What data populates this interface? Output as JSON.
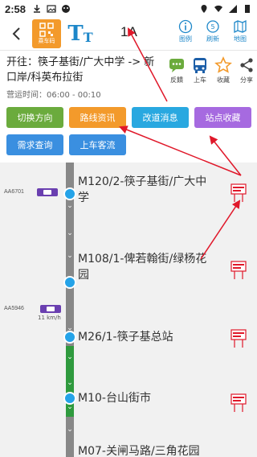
{
  "status_bar": {
    "time": "2:58"
  },
  "header": {
    "qr_label": "乘车码",
    "font_big": "T",
    "font_small": "T",
    "route": "1A",
    "actions": [
      {
        "label": "图例",
        "icon": "info-icon"
      },
      {
        "label": "刷新",
        "icon": "refresh-icon"
      },
      {
        "label": "地图",
        "icon": "map-icon"
      }
    ]
  },
  "info": {
    "destination": "开往：筷子基街/广大中学 -> 新口岸/科英布拉街",
    "operating_time": "营运时间：06:00 - 00:10",
    "actions": [
      {
        "label": "反饋",
        "icon": "feedback-icon"
      },
      {
        "label": "上车",
        "icon": "bus-icon"
      },
      {
        "label": "收藏",
        "icon": "star-icon"
      },
      {
        "label": "分享",
        "icon": "share-icon"
      }
    ]
  },
  "buttons": [
    {
      "label": "切换方向",
      "color": "#6bab3d"
    },
    {
      "label": "路线资讯",
      "color": "#f39a2b"
    },
    {
      "label": "改道消息",
      "color": "#29a8e0"
    },
    {
      "label": "站点收藏",
      "color": "#a66ae0"
    },
    {
      "label": "需求查询",
      "color": "#3a8fe0"
    },
    {
      "label": "上车客流",
      "color": "#3a8fe0"
    }
  ],
  "stops": [
    {
      "name": "M120/2-筷子基街/广大中学"
    },
    {
      "name": "M108/1-俾若翰街/绿杨花园"
    },
    {
      "name": "M26/1-筷子基总站"
    },
    {
      "name": "M10-台山街市"
    },
    {
      "name": "M07-关闸马路/三角花园"
    }
  ],
  "buses": [
    {
      "plate": "AA6701"
    },
    {
      "plate": "AA5946",
      "speed": "11 km/h"
    }
  ],
  "colors": {
    "accent": "#1d87c9",
    "stop_dot": "#25a3e8",
    "track_gray": "#888888",
    "track_green": "#2f9a3e",
    "annotation_red": "#e0182a"
  }
}
